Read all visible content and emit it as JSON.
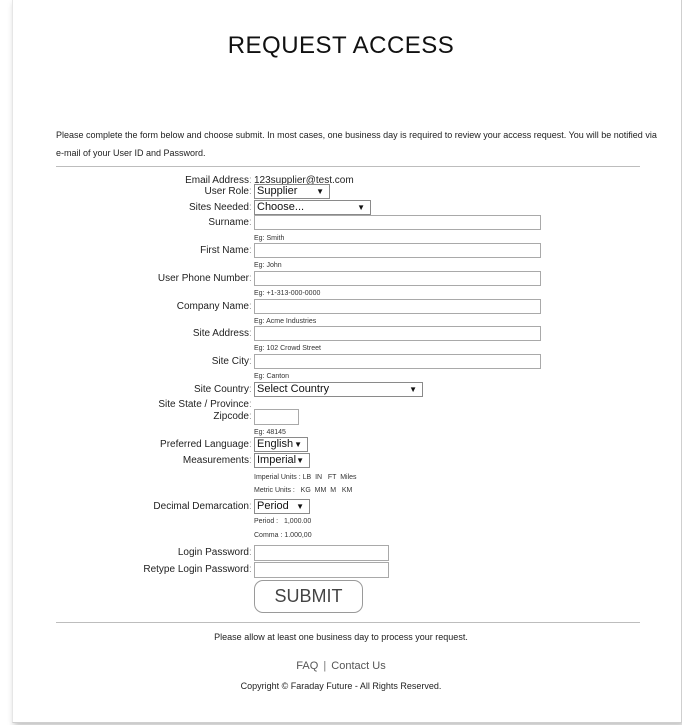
{
  "header": {
    "title": "REQUEST ACCESS"
  },
  "intro": "Please complete the form below and choose submit. In most cases, one business day is required to review your access request. You will be notified via e-mail of your User ID and Password.",
  "form": {
    "email": {
      "label": "Email Address",
      "value": "123supplier@test.com"
    },
    "user_role": {
      "label": "User Role",
      "selected": "Supplier"
    },
    "sites_needed": {
      "label": "Sites Needed",
      "selected": "Choose..."
    },
    "surname": {
      "label": "Surname",
      "value": "",
      "hint": "Eg: Smith"
    },
    "first_name": {
      "label": "First Name",
      "value": "",
      "hint": "Eg: John"
    },
    "phone": {
      "label": "User Phone Number",
      "value": "",
      "hint": "Eg: +1-313-000-0000"
    },
    "company": {
      "label": "Company Name",
      "value": "",
      "hint": "Eg: Acme Industries"
    },
    "site_address": {
      "label": "Site Address",
      "value": "",
      "hint": "Eg: 102 Crowd Street"
    },
    "site_city": {
      "label": "Site City",
      "value": "",
      "hint": "Eg: Canton"
    },
    "site_country": {
      "label": "Site Country",
      "selected": "Select Country"
    },
    "site_state": {
      "label": "Site State / Province"
    },
    "zipcode": {
      "label": "Zipcode",
      "value": "",
      "hint": "Eg: 48145"
    },
    "language": {
      "label": "Preferred Language",
      "selected": "English"
    },
    "measurements": {
      "label": "Measurements",
      "selected": "Imperial",
      "imperial_units": "Imperial Units : LB  IN   FT  Miles",
      "metric_units": "Metric Units :   KG  MM  M   KM"
    },
    "decimal": {
      "label": "Decimal Demarcation",
      "selected": "Period",
      "period_example": "Period :   1,000.00",
      "comma_example": "Comma : 1.000,00"
    },
    "login_password": {
      "label": "Login Password",
      "value": ""
    },
    "retype_password": {
      "label": "Retype Login Password",
      "value": ""
    },
    "submit_label": "SUBMIT"
  },
  "footer": {
    "notice": "Please allow at least one business day to process your request.",
    "faq_label": "FAQ",
    "separator": "|",
    "contact_label": "Contact Us",
    "copyright": "Copyright © Faraday Future - All Rights Reserved."
  },
  "icons": {
    "dropdown_arrow": "▼"
  },
  "colors": {
    "border": "#a9a9a9",
    "divider": "#bdbdbd",
    "text": "#222222"
  }
}
